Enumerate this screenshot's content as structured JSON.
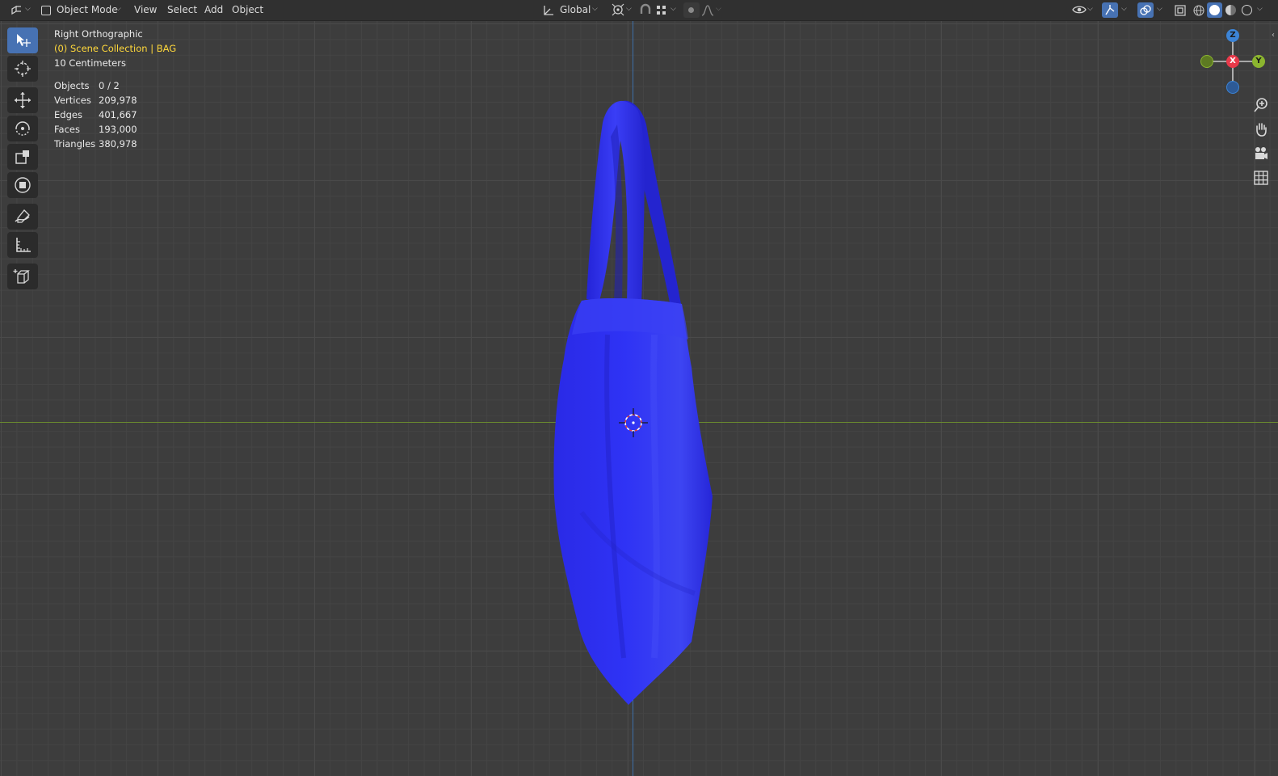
{
  "header": {
    "editor_type_icon": "3d-viewport-icon",
    "mode": "Object Mode",
    "menus": [
      "View",
      "Select",
      "Add",
      "Object"
    ],
    "orientation": "Global"
  },
  "overlay": {
    "view_name": "Right Orthographic",
    "collection": "(0) Scene Collection | BAG",
    "grid_scale": "10 Centimeters",
    "stats": [
      {
        "label": "Objects",
        "value": "0 / 2"
      },
      {
        "label": "Vertices",
        "value": "209,978"
      },
      {
        "label": "Edges",
        "value": "401,667"
      },
      {
        "label": "Faces",
        "value": "193,000"
      },
      {
        "label": "Triangles",
        "value": "380,978"
      }
    ]
  },
  "toolbar": {
    "tools": [
      "select-box-tool-icon",
      "cursor-tool-icon",
      "move-tool-icon",
      "rotate-tool-icon",
      "scale-tool-icon",
      "transform-tool-icon",
      "annotate-tool-icon",
      "measure-tool-icon",
      "add-cube-tool-icon"
    ],
    "active_tool": "select-box-tool-icon"
  },
  "gizmo": {
    "axes": {
      "x": "X",
      "y": "Y",
      "z": "Z"
    },
    "colors": {
      "x": "#e8394a",
      "y": "#8bb52f",
      "z": "#3c84d6"
    }
  },
  "colors": {
    "accent": "#4772b3",
    "mesh": "#2a2cf0",
    "collection_text": "#ffd83b",
    "axis_y": "#6a8b2f",
    "axis_z": "#3d6fa8"
  }
}
